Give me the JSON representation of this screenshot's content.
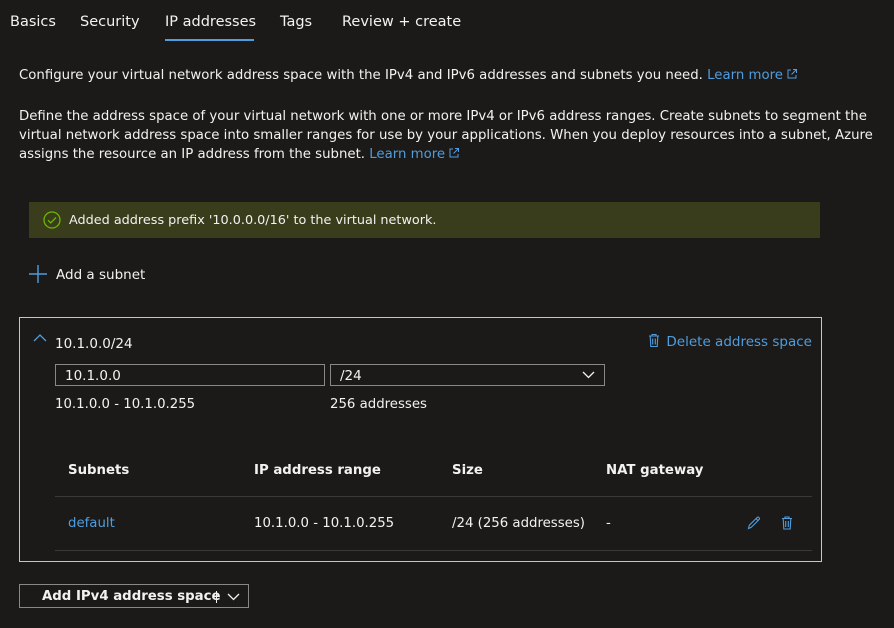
{
  "tabs": [
    {
      "label": "Basics"
    },
    {
      "label": "Security"
    },
    {
      "label": "IP addresses",
      "active": true
    },
    {
      "label": "Tags"
    },
    {
      "label": "Review + create"
    }
  ],
  "intro": {
    "text": "Configure your virtual network address space with the IPv4 and IPv6 addresses and subnets you need.",
    "link": "Learn more"
  },
  "description": {
    "line1": "Define the address space of your virtual network with one or more IPv4 or IPv6 address ranges. Create subnets to segment the",
    "line2": "virtual network address space into smaller ranges for use by your applications. When you deploy resources into a subnet, Azure",
    "line3": "assigns the resource an IP address from the subnet.",
    "link": "Learn more"
  },
  "banner": {
    "text": "Added address prefix '10.0.0.0/16' to the virtual network.",
    "color": "#393d1b"
  },
  "add_subnet_label": "Add a subnet",
  "address_space": {
    "title": "10.1.0.0/24",
    "delete_label": "Delete address space",
    "address_value": "10.1.0.0",
    "prefix_value": "/24",
    "range_text": "10.1.0.0 - 10.1.0.255",
    "count_text": "256 addresses",
    "columns": [
      "Subnets",
      "IP address range",
      "Size",
      "NAT gateway"
    ],
    "rows": [
      {
        "name": "default",
        "range": "10.1.0.0 - 10.1.0.255",
        "size": "/24 (256 addresses)",
        "nat": "-"
      }
    ]
  },
  "add_space_button": "Add IPv4 address space",
  "accent_color": "#4f9dde"
}
